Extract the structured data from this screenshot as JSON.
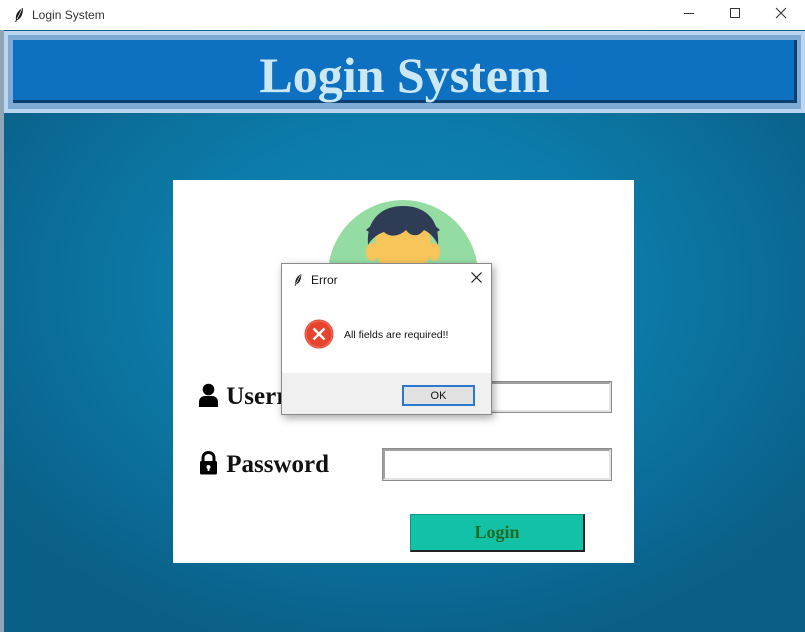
{
  "window": {
    "title": "Login System",
    "icons": {
      "app": "feather-icon",
      "minimize": "minimize-icon",
      "maximize": "maximize-icon",
      "close": "close-icon"
    }
  },
  "header": {
    "title": "Login System"
  },
  "form": {
    "username_label": "Username",
    "username_visible_label": "Userr",
    "username_value": "",
    "password_label": "Password",
    "password_value": "",
    "login_label": "Login",
    "icons": {
      "user": "user-icon",
      "lock": "lock-icon",
      "avatar": "avatar-icon"
    }
  },
  "dialog": {
    "title": "Error",
    "message": "All fields are required!!",
    "ok_label": "OK",
    "icons": {
      "app": "feather-icon",
      "close": "close-icon",
      "error": "error-icon"
    }
  },
  "colors": {
    "background": "#0c7ba9",
    "header_bg": "#0d70c0",
    "header_text": "#cce8f5",
    "login_button": "#13c1a6",
    "login_text": "#1d6b24",
    "error_red": "#e8432e"
  }
}
